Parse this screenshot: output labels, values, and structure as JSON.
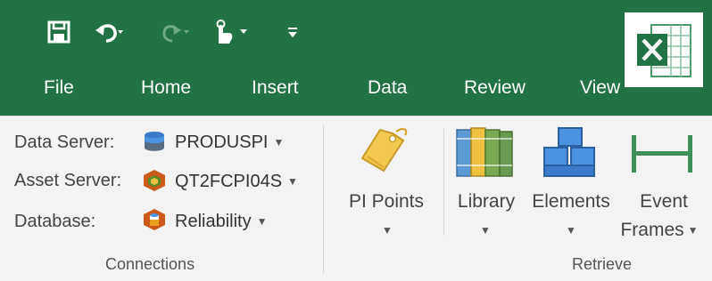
{
  "qat": {
    "icons": [
      "save-icon",
      "undo-icon",
      "redo-icon",
      "touch-mode-icon",
      "customize-qat-icon"
    ]
  },
  "tabs": [
    {
      "label": "File"
    },
    {
      "label": "Home"
    },
    {
      "label": "Insert"
    },
    {
      "label": "Data"
    },
    {
      "label": "Review"
    },
    {
      "label": "View"
    }
  ],
  "connections": {
    "data_server_label": "Data Server:",
    "data_server_value": "PRODUSPI",
    "asset_server_label": "Asset Server:",
    "asset_server_value": "QT2FCPI04S",
    "database_label": "Database:",
    "database_value": "Reliability",
    "group_label": "Connections"
  },
  "retrieve": {
    "pi_points_label": "PI Points",
    "library_label": "Library",
    "elements_label": "Elements",
    "event_frames_label_1": "Event",
    "event_frames_label_2": "Frames",
    "group_label": "Retrieve"
  },
  "colors": {
    "excel_green": "#217346",
    "ribbon_bg": "#f3f3f3"
  }
}
